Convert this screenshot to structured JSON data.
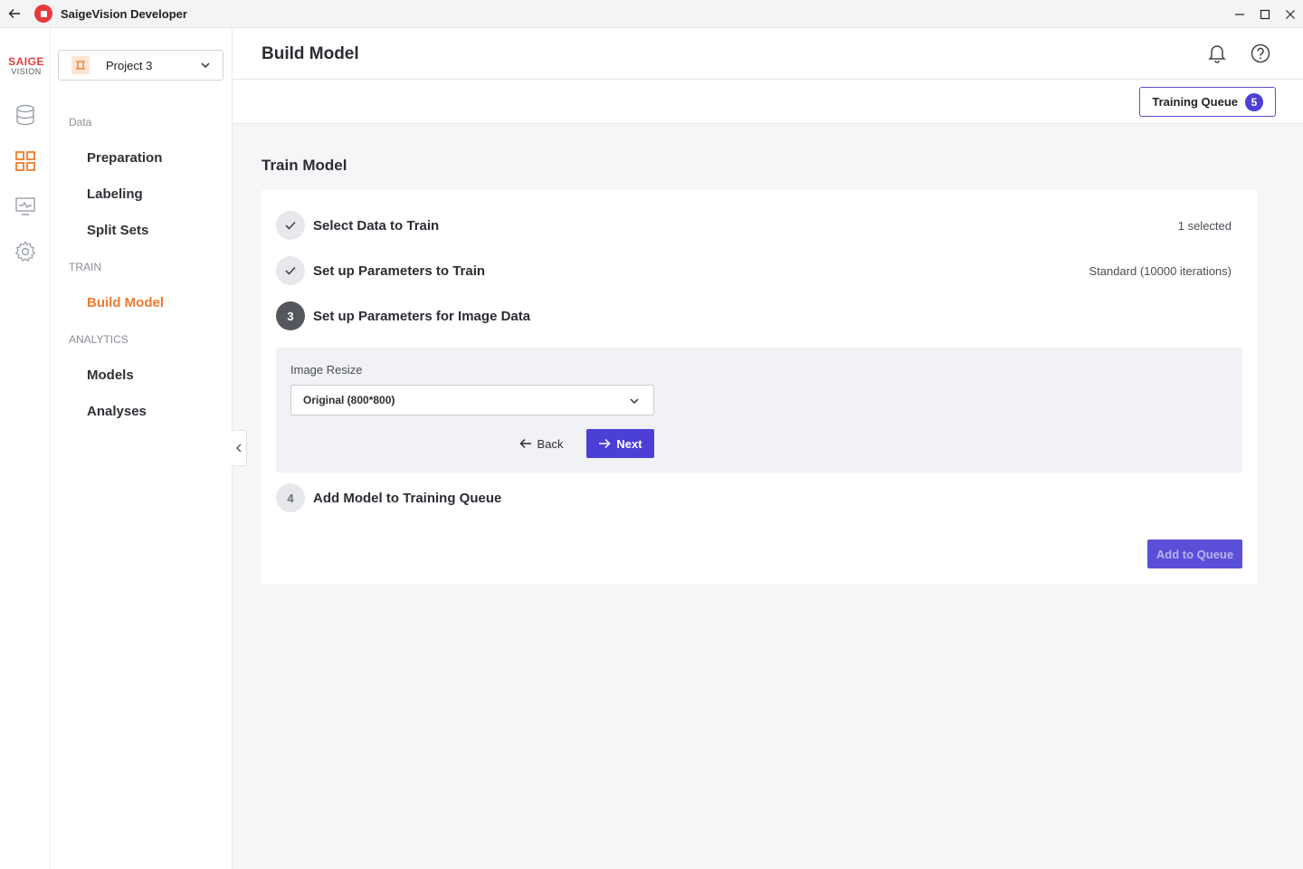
{
  "window": {
    "title": "SaigeVision Developer"
  },
  "brand": {
    "line1": "SAIGE",
    "line2": "VISION"
  },
  "rail": [
    "database-icon",
    "dashboard-icon",
    "monitor-icon",
    "gear-icon"
  ],
  "project": {
    "selected": "Project 3"
  },
  "nav": {
    "sections": [
      {
        "label": "Data",
        "items": [
          "Preparation",
          "Labeling",
          "Split Sets"
        ]
      },
      {
        "label": "TRAIN",
        "items": [
          "Build Model"
        ]
      },
      {
        "label": "ANALYTICS",
        "items": [
          "Models",
          "Analyses"
        ]
      }
    ],
    "active": "Build Model"
  },
  "header": {
    "title": "Build Model"
  },
  "queue": {
    "label": "Training Queue",
    "count": "5"
  },
  "main": {
    "section_title": "Train Model",
    "steps": [
      {
        "number": "",
        "label": "Select Data to Train",
        "value": "1 selected",
        "state": "done"
      },
      {
        "number": "",
        "label": "Set up Parameters to Train",
        "value": "Standard (10000 iterations)",
        "state": "done"
      },
      {
        "number": "3",
        "label": "Set up Parameters for Image Data",
        "value": "",
        "state": "current"
      },
      {
        "number": "4",
        "label": "Add Model to Training Queue",
        "value": "",
        "state": "pending"
      }
    ],
    "image_resize": {
      "label": "Image Resize",
      "value": "Original (800*800)"
    },
    "back_label": "Back",
    "next_label": "Next",
    "add_to_queue_label": "Add to Queue"
  },
  "colors": {
    "accent": "#4b3fd6",
    "brand": "#e83a3a",
    "active_nav": "#f07b2e"
  }
}
